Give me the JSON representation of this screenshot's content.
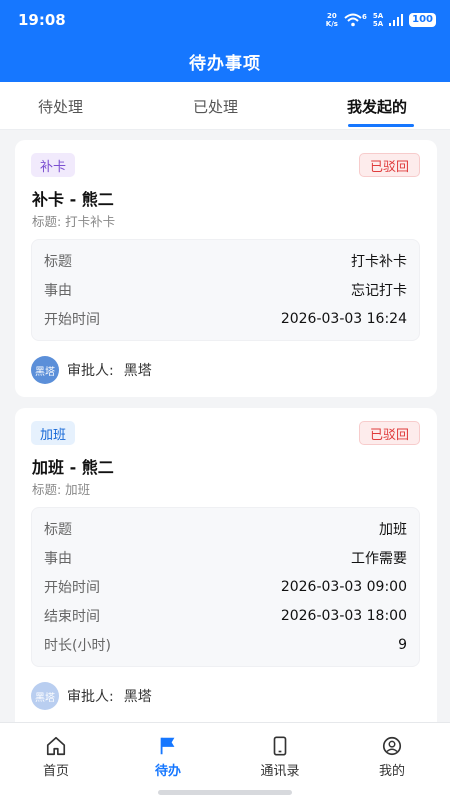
{
  "status_bar": {
    "time": "19:08",
    "net_speed_value": "20",
    "net_speed_unit": "K/s",
    "wifi_badge": "6",
    "sig1": "5A",
    "sig2": "5A",
    "battery": "100"
  },
  "header": {
    "title": "待办事项"
  },
  "tabs": [
    {
      "label": "待处理"
    },
    {
      "label": "已处理"
    },
    {
      "label": "我发起的",
      "active": true
    }
  ],
  "cards": [
    {
      "type_tag": "补卡",
      "type_color": "#7b4fd1",
      "type_bg": "#f1eafc",
      "status": "已驳回",
      "title": "补卡 - 熊二",
      "subtitle": "标题: 打卡补卡",
      "rows": [
        {
          "label": "标题",
          "value": "打卡补卡"
        },
        {
          "label": "事由",
          "value": "忘记打卡"
        },
        {
          "label": "开始时间",
          "value": "2026-03-03 16:24"
        }
      ],
      "approver_label": "审批人:",
      "approver_name": "黑塔",
      "avatar_text": "黑塔"
    },
    {
      "type_tag": "加班",
      "type_color": "#1668d6",
      "type_bg": "#e6f1fd",
      "status": "已驳回",
      "title": "加班 - 熊二",
      "subtitle": "标题: 加班",
      "rows": [
        {
          "label": "标题",
          "value": "加班"
        },
        {
          "label": "事由",
          "value": "工作需要"
        },
        {
          "label": "开始时间",
          "value": "2026-03-03 09:00"
        },
        {
          "label": "结束时间",
          "value": "2026-03-03 18:00"
        },
        {
          "label": "时长(小时)",
          "value": "9"
        }
      ],
      "approver_label": "审批人:",
      "approver_name": "黑塔",
      "avatar_text": "黑塔"
    }
  ],
  "bottom_nav": [
    {
      "label": "首页",
      "icon": "home-icon"
    },
    {
      "label": "待办",
      "icon": "flag-icon",
      "active": true
    },
    {
      "label": "通讯录",
      "icon": "phone-icon"
    },
    {
      "label": "我的",
      "icon": "user-icon"
    }
  ],
  "colors": {
    "primary": "#1677ff",
    "rejected": "#e03c3c"
  }
}
